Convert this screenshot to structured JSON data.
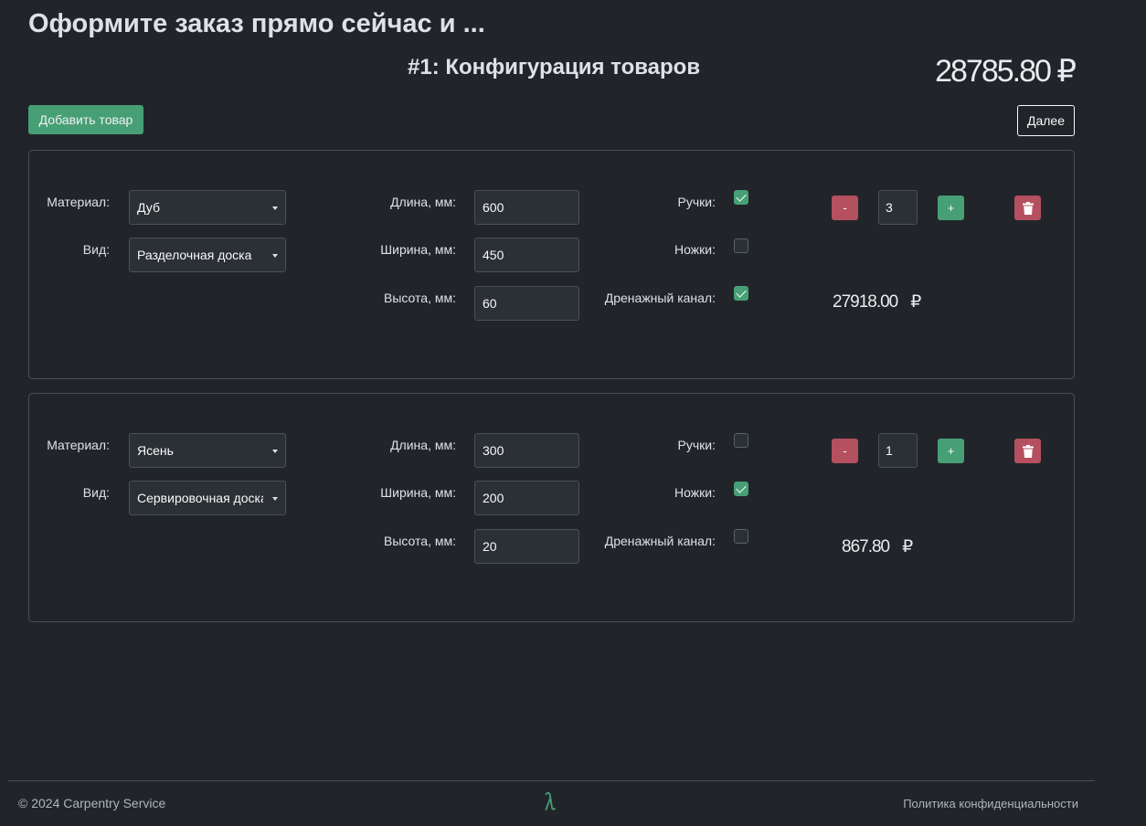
{
  "header": {
    "title": "Оформите заказ прямо сейчас и ...",
    "step_title": "#1: Конфигурация товаров",
    "total_price": "28785.80 ₽"
  },
  "actions": {
    "add_item_label": "Добавить товар",
    "next_label": "Далее"
  },
  "labels": {
    "material": "Материал:",
    "type": "Вид:",
    "length": "Длина, мм:",
    "width": "Ширина, мм:",
    "height": "Высота, мм:",
    "handles": "Ручки:",
    "legs": "Ножки:",
    "drain": "Дренажный канал:",
    "minus": "-",
    "plus": "+"
  },
  "items": [
    {
      "material": "Дуб",
      "type": "Разделочная доска",
      "length": "600",
      "width": "450",
      "height": "60",
      "handles": true,
      "legs": false,
      "drain": true,
      "quantity": "3",
      "price_value": "27918.00",
      "currency": "₽"
    },
    {
      "material": "Ясень",
      "type": "Сервировочная доска",
      "length": "300",
      "width": "200",
      "height": "20",
      "handles": false,
      "legs": true,
      "drain": false,
      "quantity": "1",
      "price_value": "867.80",
      "currency": "₽"
    }
  ],
  "footer": {
    "copyright": "© 2024 Carpentry Service",
    "privacy_link": "Политика конфиденциальности",
    "logo_icon": "lambda-logo-icon"
  },
  "colors": {
    "background": "#212529",
    "success": "#479f76",
    "danger": "#b4505f",
    "input_bg": "#2b3035",
    "border": "#495057"
  }
}
